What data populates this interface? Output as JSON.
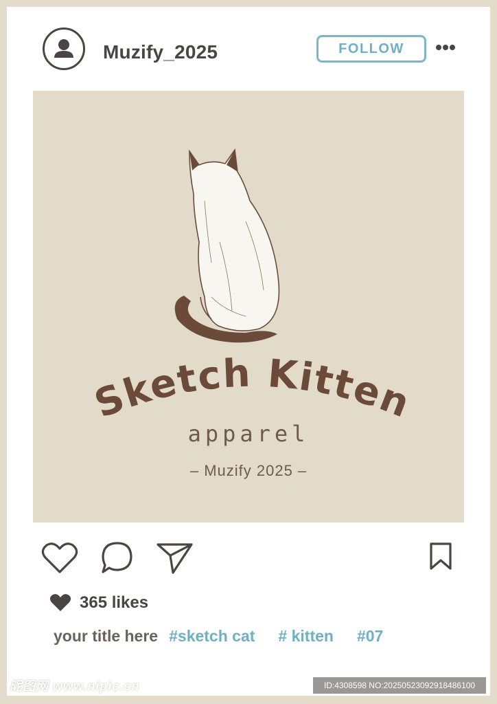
{
  "header": {
    "avatar_icon": "user-avatar-icon",
    "username": "Muzify_2025",
    "follow_label": "FOLLOW",
    "more_icon": "more-options-icon"
  },
  "post_image": {
    "brand_title": "Sketch Kitten",
    "brand_subtitle": "apparel",
    "brand_credit": "– Muzify 2025 –",
    "illustration": "cat-sketch-illustration"
  },
  "actions": {
    "like_icon": "heart-outline-icon",
    "comment_icon": "comment-bubble-icon",
    "share_icon": "paper-plane-icon",
    "save_icon": "bookmark-icon"
  },
  "stats": {
    "likes_label": "365 likes"
  },
  "caption": {
    "title": "your title here",
    "hashtags": [
      "#sketch cat",
      "# kitten",
      "#07"
    ]
  },
  "watermarks": {
    "site": "昵图网 www.nipic.cn",
    "id_info": "ID:4308598 NO:20250523092918486100"
  },
  "colors": {
    "frame": "#e3dccb",
    "card": "#ffffff",
    "text_dark": "#4a4543",
    "accent_blue": "#6fb0c2",
    "image_bg": "#e3dbca",
    "cat_brown": "#6b4a3a"
  }
}
